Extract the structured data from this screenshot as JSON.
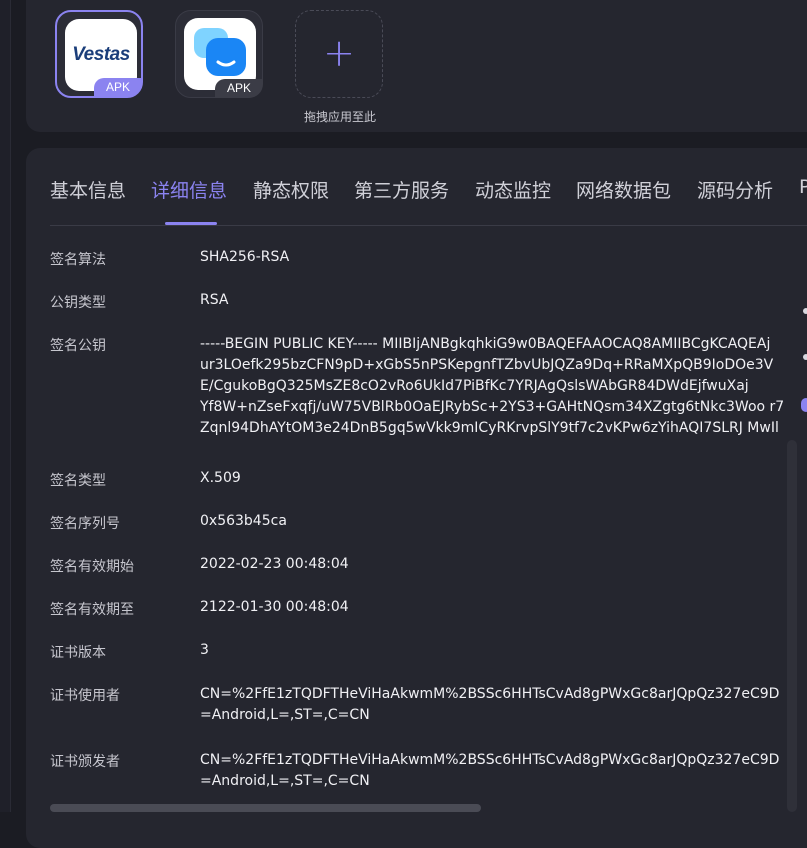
{
  "apps": [
    {
      "name": "Vestas",
      "badge": "APK"
    },
    {
      "name": "chat-bot-app",
      "badge": "APK"
    }
  ],
  "add_app": {
    "plus": "+",
    "label": "拖拽应用至此"
  },
  "tabs": [
    "基本信息",
    "详细信息",
    "静态权限",
    "第三方服务",
    "动态监控",
    "网络数据包",
    "源码分析",
    "P"
  ],
  "active_tab": "详细信息",
  "details": {
    "sig_algo": {
      "label": "签名算法",
      "value": "SHA256-RSA"
    },
    "key_type": {
      "label": "公钥类型",
      "value": "RSA"
    },
    "public_key": {
      "label": "签名公钥",
      "lines": [
        "-----BEGIN PUBLIC KEY----- MIIBIjANBgkqhkiG9w0BAQEFAAOCAQ8AMIIBCgKCAQEAj",
        "ur3LOefk295bzCFN9pD+xGbS5nPSKepgnfTZbvUbJQZa9Dq+RRaMXpQB9IoDOe3V",
        "E/CgukoBgQ325MsZE8cO2vRo6UkId7PiBfKc7YRJAgQslsWAbGR84DWdEjfwuXaj",
        "Yf8W+nZseFxqfj/uW75VBlRb0OaEJRybSc+2YS3+GAHtNQsm34XZgtg6tNkc3Woo r7",
        "Zqnl94DhAYtOM3e24DnB5gq5wVkk9mICyRKrvpSlY9tf7c2vKPw6zYihAQI7SLRJ MwIl"
      ]
    },
    "sig_type": {
      "label": "签名类型",
      "value": "X.509"
    },
    "serial": {
      "label": "签名序列号",
      "value": "0x563b45ca"
    },
    "valid_from": {
      "label": "签名有效期始",
      "value": "2022-02-23 00:48:04"
    },
    "valid_to": {
      "label": "签名有效期至",
      "value": "2122-01-30 00:48:04"
    },
    "version": {
      "label": "证书版本",
      "value": "3"
    },
    "subject": {
      "label": "证书使用者",
      "lines": [
        "CN=%2FfE1zTQDFTHeViHaAkwmM%2BSSc6HHTsCvAd8gPWxGc8arJQpQz327eC9D",
        "=Android,L=,ST=,C=CN"
      ]
    },
    "issuer": {
      "label": "证书颁发者",
      "lines": [
        "CN=%2FfE1zTQDFTHeViHaAkwmM%2BSSc6HHTsCvAd8gPWxGc8arJQpQz327eC9D",
        "=Android,L=,ST=,C=CN"
      ]
    }
  },
  "colors": {
    "accent": "#8b83f0",
    "panel": "#25262f",
    "background": "#1b1c23"
  }
}
